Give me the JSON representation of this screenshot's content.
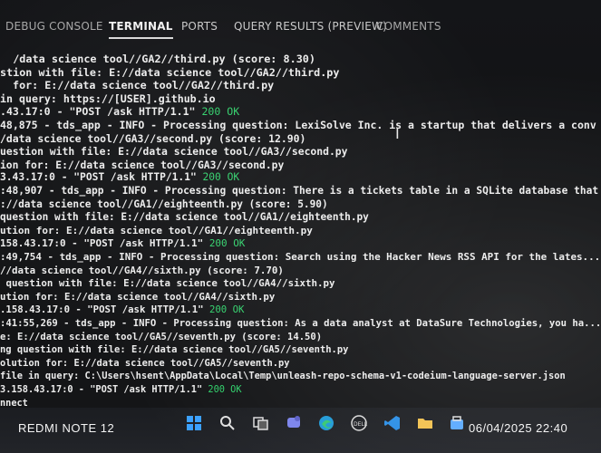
{
  "tabs": [
    {
      "label": "DEBUG CONSOLE",
      "active": false
    },
    {
      "label": "TERMINAL",
      "active": true
    },
    {
      "label": "PORTS",
      "active": false
    },
    {
      "label": "QUERY RESULTS (PREVIEW)",
      "active": false
    },
    {
      "label": "COMMENTS",
      "active": false
    }
  ],
  "terminal": {
    "lines": [
      {
        "text": "  /data science tool//GA2//third.py (score: 8.30)"
      },
      {
        "text": "stion with file: E://data science tool//GA2//third.py"
      },
      {
        "text": "  for: E://data science tool//GA2//third.py"
      },
      {
        "text": "in query: https://[USER].github.io"
      },
      {
        "text": ".43.17:0 - \"POST /ask HTTP/1.1\" ",
        "status": "200 OK"
      },
      {
        "text": "48,875 - tds_app - INFO - Processing question: LexiSolve Inc. is a startup that delivers a conv"
      },
      {
        "text": "/data science tool//GA3//second.py (score: 12.90)"
      },
      {
        "text": "uestion with file: E://data science tool//GA3//second.py"
      },
      {
        "text": "ion for: E://data science tool//GA3//second.py"
      },
      {
        "text": "3.43.17:0 - \"POST /ask HTTP/1.1\" ",
        "status": "200 OK"
      },
      {
        "text": ":48,907 - tds_app - INFO - Processing question: There is a tickets table in a SQLite database that"
      },
      {
        "text": "://data science tool//GA1//eighteenth.py (score: 5.90)"
      },
      {
        "text": "question with file: E://data science tool//GA1//eighteenth.py"
      },
      {
        "text": "ution for: E://data science tool//GA1//eighteenth.py"
      },
      {
        "text": "158.43.17:0 - \"POST /ask HTTP/1.1\" ",
        "status": "200 OK"
      },
      {
        "text": ":49,754 - tds_app - INFO - Processing question: Search using the Hacker News RSS API for the lates..."
      },
      {
        "text": "//data science tool//GA4//sixth.py (score: 7.70)"
      },
      {
        "text": " question with file: E://data science tool//GA4//sixth.py"
      },
      {
        "text": "ution for: E://data science tool//GA4//sixth.py"
      },
      {
        "text": ".158.43.17:0 - \"POST /ask HTTP/1.1\" ",
        "status": "200 OK"
      },
      {
        "text": ":41:55,269 - tds_app - INFO - Processing question: As a data analyst at DataSure Technologies, you ha..."
      },
      {
        "text": "e: E://data science tool//GA5//seventh.py (score: 14.50)"
      },
      {
        "text": "ng question with file: E://data science tool//GA5//seventh.py"
      },
      {
        "text": "olution for: E://data science tool//GA5//seventh.py"
      },
      {
        "text": "file in query: C:\\Users\\hsent\\AppData\\Local\\Temp\\unleash-repo-schema-v1-codeium-language-server.json"
      },
      {
        "text": "3.158.43.17:0 - \"POST /ask HTTP/1.1\" ",
        "status": "200 OK"
      },
      {
        "text": "nnect"
      }
    ]
  },
  "camera": {
    "model": "REDMI NOTE 12",
    "datetime": "06/04/2025  22:40"
  },
  "taskbar": {
    "icons": [
      "windows-start-icon",
      "search-icon",
      "task-view-icon",
      "widgets-icon",
      "teams-chat-icon",
      "edge-browser-icon",
      "dell-icon",
      "vscode-icon",
      "file-explorer-icon",
      "store-icon",
      "terminal-icon",
      "mail-icon"
    ]
  },
  "colors": {
    "ok_green": "#2fd06a",
    "text": "#ececec",
    "background": "#111214"
  }
}
